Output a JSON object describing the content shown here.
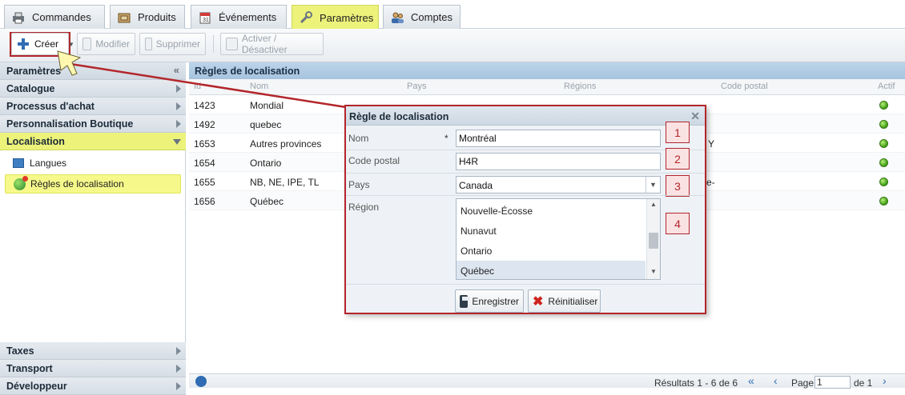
{
  "tabs": [
    {
      "label": "Commandes",
      "icon": "printer-icon"
    },
    {
      "label": "Produits",
      "icon": "box-icon"
    },
    {
      "label": "Événements",
      "icon": "calendar-icon"
    },
    {
      "label": "Paramètres",
      "icon": "wrench-icon",
      "active": true
    },
    {
      "label": "Comptes",
      "icon": "users-icon"
    }
  ],
  "toolbar": {
    "create": "Créer",
    "modify": "Modifier",
    "delete": "Supprimer",
    "toggle": "Activer / Désactiver"
  },
  "sidebar": {
    "title": "Paramètres",
    "sections_top": [
      "Catalogue",
      "Processus d'achat",
      "Personnalisation Boutique"
    ],
    "selected_section": "Localisation",
    "items": [
      "Langues",
      "Règles de localisation"
    ],
    "sections_bottom": [
      "Taxes",
      "Transport",
      "Développeur"
    ]
  },
  "grid": {
    "title": "Règles de localisation",
    "columns": [
      "Id",
      "Nom",
      "Pays",
      "Régions",
      "Code postal",
      "Actif"
    ],
    "rows": [
      {
        "id": "1423",
        "name": "Mondial"
      },
      {
        "id": "1492",
        "name": "quebec"
      },
      {
        "id": "1653",
        "name": "Autres provinces"
      },
      {
        "id": "1654",
        "name": "Ontario"
      },
      {
        "id": "1655",
        "name": "NB, NE, IPE, TL"
      },
      {
        "id": "1656",
        "name": "Québec"
      }
    ],
    "partial_text_row3": "Y",
    "partial_text_row5": "e-"
  },
  "pager": {
    "results": "Résultats 1 - 6 de 6",
    "page_label": "Page",
    "page_value": "1",
    "of": "de 1"
  },
  "dialog": {
    "title": "Règle de localisation",
    "name_label": "Nom",
    "required": "*",
    "name_value": "Montréal",
    "postal_label": "Code postal",
    "postal_value": "H4R",
    "country_label": "Pays",
    "country_value": "Canada",
    "region_label": "Région",
    "regions": [
      "Nouvelle-Écosse",
      "Nunavut",
      "Ontario",
      "Québec"
    ],
    "save": "Enregistrer",
    "reset": "Réinitialiser"
  },
  "callouts": [
    "1",
    "2",
    "3",
    "4"
  ],
  "colors": {
    "highlight": "#ecf27a",
    "annotation": "#b3262b",
    "grid_header": "#a6c3de"
  }
}
